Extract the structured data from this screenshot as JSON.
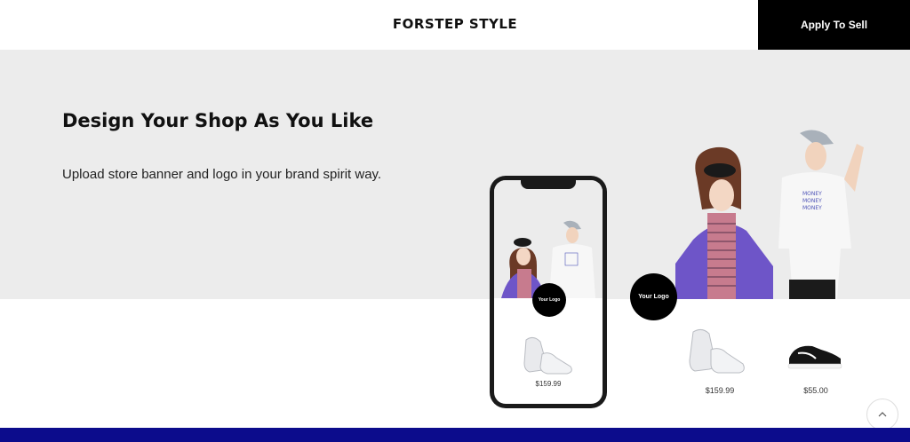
{
  "header": {
    "brand": "FORSTEP STYLE",
    "apply_label": "Apply To Sell"
  },
  "hero": {
    "title": "Design Your Shop As You Like",
    "description": "Upload store banner and logo in your brand spirit way."
  },
  "phone_preview": {
    "logo_text": "Your Logo",
    "product_price": "$159.99"
  },
  "store_preview": {
    "logo_text": "Your Logo",
    "products": [
      {
        "price": "$159.99",
        "icon": "white-sneaker"
      },
      {
        "price": "$55.00",
        "icon": "black-sneaker"
      }
    ]
  },
  "colors": {
    "accent_black": "#000000",
    "hero_bg": "#ececec",
    "footer_blue": "#0c0c8c",
    "jacket_purple": "#6e55c8"
  }
}
